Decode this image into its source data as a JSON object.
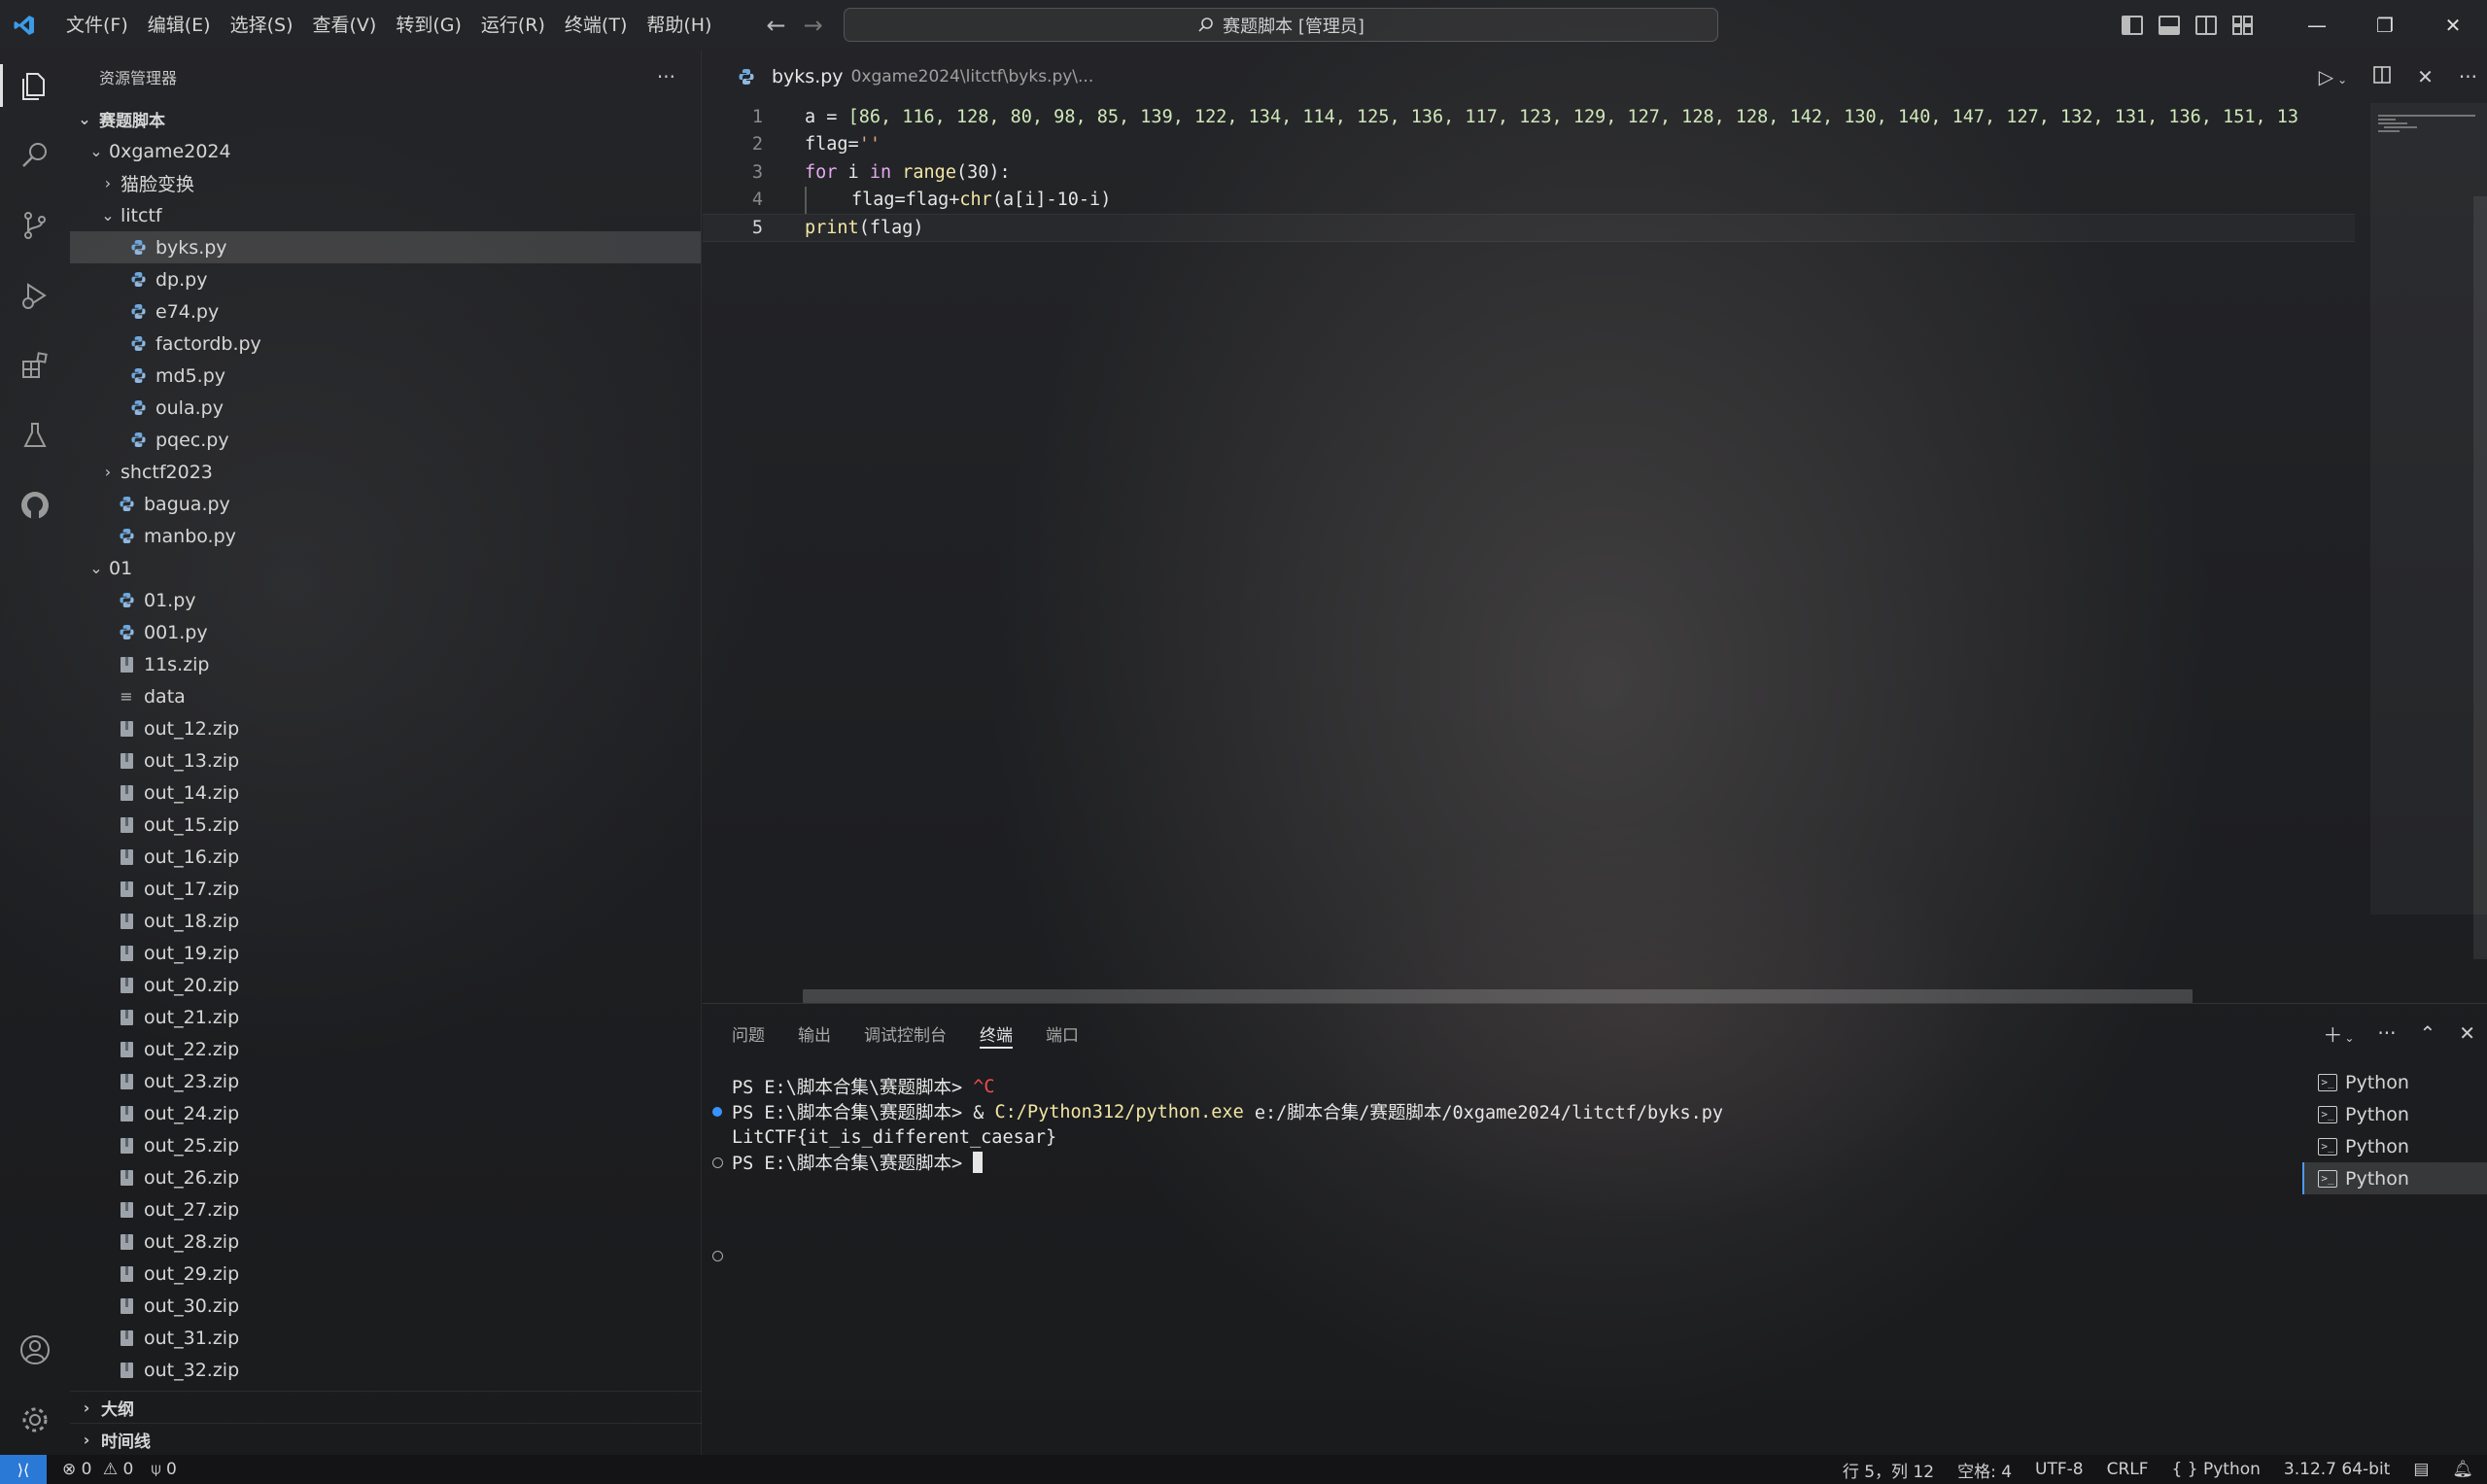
{
  "window": {
    "title": "赛题脚本 [管理员]"
  },
  "menu": [
    "文件(F)",
    "编辑(E)",
    "选择(S)",
    "查看(V)",
    "转到(G)",
    "运行(R)",
    "终端(T)",
    "帮助(H)"
  ],
  "sidebar": {
    "title": "资源管理器",
    "more": "···",
    "root": "赛题脚本",
    "tree": [
      {
        "label": "0xgame2024",
        "depth": 1,
        "kind": "folder-open"
      },
      {
        "label": "猫脸变换",
        "depth": 2,
        "kind": "folder-closed"
      },
      {
        "label": "litctf",
        "depth": 2,
        "kind": "folder-open"
      },
      {
        "label": "byks.py",
        "depth": 3,
        "kind": "py",
        "selected": true
      },
      {
        "label": "dp.py",
        "depth": 3,
        "kind": "py"
      },
      {
        "label": "e74.py",
        "depth": 3,
        "kind": "py"
      },
      {
        "label": "factordb.py",
        "depth": 3,
        "kind": "py"
      },
      {
        "label": "md5.py",
        "depth": 3,
        "kind": "py"
      },
      {
        "label": "oula.py",
        "depth": 3,
        "kind": "py"
      },
      {
        "label": "pqec.py",
        "depth": 3,
        "kind": "py"
      },
      {
        "label": "shctf2023",
        "depth": 2,
        "kind": "folder-closed"
      },
      {
        "label": "bagua.py",
        "depth": 2,
        "kind": "py"
      },
      {
        "label": "manbo.py",
        "depth": 2,
        "kind": "py"
      },
      {
        "label": "01",
        "depth": 1,
        "kind": "folder-open"
      },
      {
        "label": "01.py",
        "depth": 2,
        "kind": "py"
      },
      {
        "label": "001.py",
        "depth": 2,
        "kind": "py"
      },
      {
        "label": "11s.zip",
        "depth": 2,
        "kind": "zip"
      },
      {
        "label": "data",
        "depth": 2,
        "kind": "data"
      },
      {
        "label": "out_12.zip",
        "depth": 2,
        "kind": "zip"
      },
      {
        "label": "out_13.zip",
        "depth": 2,
        "kind": "zip"
      },
      {
        "label": "out_14.zip",
        "depth": 2,
        "kind": "zip"
      },
      {
        "label": "out_15.zip",
        "depth": 2,
        "kind": "zip"
      },
      {
        "label": "out_16.zip",
        "depth": 2,
        "kind": "zip"
      },
      {
        "label": "out_17.zip",
        "depth": 2,
        "kind": "zip"
      },
      {
        "label": "out_18.zip",
        "depth": 2,
        "kind": "zip"
      },
      {
        "label": "out_19.zip",
        "depth": 2,
        "kind": "zip"
      },
      {
        "label": "out_20.zip",
        "depth": 2,
        "kind": "zip"
      },
      {
        "label": "out_21.zip",
        "depth": 2,
        "kind": "zip"
      },
      {
        "label": "out_22.zip",
        "depth": 2,
        "kind": "zip"
      },
      {
        "label": "out_23.zip",
        "depth": 2,
        "kind": "zip"
      },
      {
        "label": "out_24.zip",
        "depth": 2,
        "kind": "zip"
      },
      {
        "label": "out_25.zip",
        "depth": 2,
        "kind": "zip"
      },
      {
        "label": "out_26.zip",
        "depth": 2,
        "kind": "zip"
      },
      {
        "label": "out_27.zip",
        "depth": 2,
        "kind": "zip"
      },
      {
        "label": "out_28.zip",
        "depth": 2,
        "kind": "zip"
      },
      {
        "label": "out_29.zip",
        "depth": 2,
        "kind": "zip"
      },
      {
        "label": "out_30.zip",
        "depth": 2,
        "kind": "zip"
      },
      {
        "label": "out_31.zip",
        "depth": 2,
        "kind": "zip"
      },
      {
        "label": "out_32.zip",
        "depth": 2,
        "kind": "zip"
      }
    ],
    "sections": [
      "大纲",
      "时间线"
    ]
  },
  "editor": {
    "tab_name": "byks.py",
    "tab_path": "0xgame2024\\litctf\\byks.py\\...",
    "line_numbers": [
      "1",
      "2",
      "3",
      "4",
      "5"
    ],
    "current_line": 5,
    "code": {
      "l1_var": "a",
      "l1_eq": " = ",
      "l1_list": "[86, 116, 128, 80, 98, 85, 139, 122, 134, 114, 125, 136, 117, 123, 129, 127, 128, 128, 142, 130, 140, 147, 127, 132, 131, 136, 151, 13",
      "l2_var": "flag=",
      "l2_str": "''",
      "l3_for": "for",
      "l3_i": " i ",
      "l3_in": "in",
      "l3_space": " ",
      "l3_range": "range",
      "l3_args": "(30):",
      "l4_a": "flag=flag+",
      "l4_chr": "chr",
      "l4_rest": "(a[i]-10-i)",
      "l5_print": "print",
      "l5_rest": "(flag)"
    }
  },
  "panel": {
    "tabs": [
      "问题",
      "输出",
      "调试控制台",
      "终端",
      "端口"
    ],
    "active_tab": "终端",
    "terminal_lines": {
      "t1_prompt": "PS E:\\脚本合集\\赛题脚本> ",
      "t1_ctrl": "^C",
      "t2_prompt": "PS E:\\脚本合集\\赛题脚本> & ",
      "t2_exe": "C:/Python312/python.exe",
      "t2_arg": " e:/脚本合集/赛题脚本/0xgame2024/litctf/byks.py",
      "t3_out": "LitCTF{it_is_different_caesar}",
      "t4_prompt": "PS E:\\脚本合集\\赛题脚本> "
    },
    "terminals": [
      "Python",
      "Python",
      "Python",
      "Python"
    ]
  },
  "statusbar": {
    "errors": "0",
    "warnings": "0",
    "ports": "0",
    "position": "行 5，列 12",
    "spaces": "空格: 4",
    "encoding": "UTF-8",
    "eol": "CRLF",
    "language": "Python",
    "interpreter": "3.12.7 64-bit",
    "language_braces": "{ }"
  },
  "colors": {
    "accent": "#2b79d6",
    "keyword": "#e5a9f0",
    "function": "#f2e6a2",
    "string": "#e3a780"
  }
}
